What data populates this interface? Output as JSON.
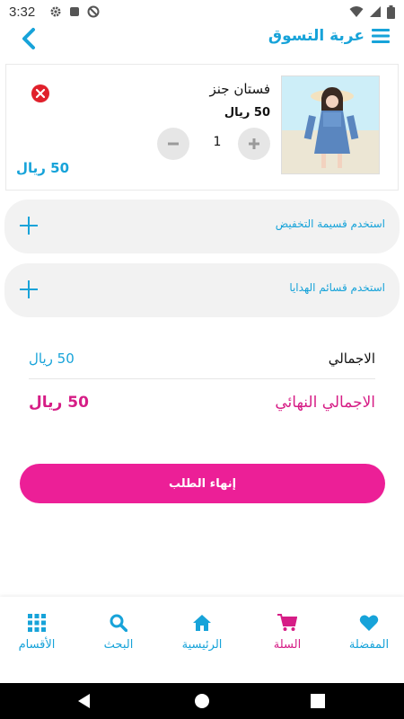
{
  "status_bar": {
    "time": "3:32",
    "icons": [
      "gear-icon",
      "square-icon",
      "no-sync-icon",
      "wifi-icon",
      "signal-icon",
      "battery-icon"
    ]
  },
  "header": {
    "title": "عربة التسوق",
    "back_icon": "chevron-left-icon",
    "menu_icon": "hamburger-icon"
  },
  "cart_items": [
    {
      "name": "فستان جنز",
      "price": "50 ريال",
      "quantity": "1",
      "total": "50 ريال",
      "image": "product-photo"
    }
  ],
  "coupons": {
    "discount_label": "استخدم قسيمة التخفيض",
    "gift_label": "استخدم قسائم الهدايا"
  },
  "totals": {
    "subtotal_label": "الاجمالي",
    "subtotal_value": "50 ريال",
    "final_label": "الاجمالي النهائي",
    "final_value": "50 ريال"
  },
  "checkout": {
    "label": "إنهاء الطلب"
  },
  "bottom_nav": {
    "items": [
      {
        "label": "المفضلة",
        "icon": "heart-icon",
        "active": false
      },
      {
        "label": "السلة",
        "icon": "cart-icon",
        "active": true
      },
      {
        "label": "الرئيسية",
        "icon": "home-icon",
        "active": false
      },
      {
        "label": "البحث",
        "icon": "search-icon",
        "active": false
      },
      {
        "label": "الأقسام",
        "icon": "grid-icon",
        "active": false
      }
    ]
  },
  "colors": {
    "accent_blue": "#17a3d9",
    "accent_pink": "#d61d86",
    "button_pink": "#ec1f97",
    "remove_red": "#e0202b"
  }
}
